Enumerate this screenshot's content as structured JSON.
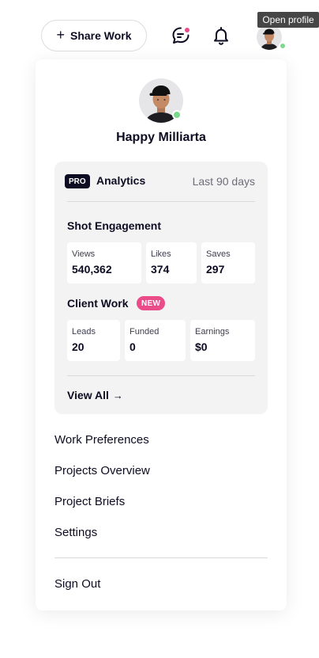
{
  "topbar": {
    "share_label": "Share Work",
    "share_icon": "plus-icon",
    "messages_icon": "chat-bubble-icon",
    "notifications_icon": "bell-icon",
    "tooltip": "Open profile",
    "accent_color": "#ea4c89",
    "online_color": "#7bd88f"
  },
  "profile": {
    "name": "Happy Milliarta"
  },
  "analytics": {
    "badge": "PRO",
    "title": "Analytics",
    "range": "Last 90 days",
    "shot_engagement": {
      "title": "Shot Engagement",
      "stats": [
        {
          "label": "Views",
          "value": "540,362"
        },
        {
          "label": "Likes",
          "value": "374"
        },
        {
          "label": "Saves",
          "value": "297"
        }
      ]
    },
    "client_work": {
      "title": "Client Work",
      "badge": "NEW",
      "stats": [
        {
          "label": "Leads",
          "value": "20"
        },
        {
          "label": "Funded",
          "value": "0"
        },
        {
          "label": "Earnings",
          "value": "$0"
        }
      ]
    },
    "view_all": "View All",
    "view_all_arrow": "→"
  },
  "menu": {
    "items": [
      {
        "label": "Work Preferences"
      },
      {
        "label": "Projects Overview"
      },
      {
        "label": "Project Briefs"
      },
      {
        "label": "Settings"
      }
    ],
    "sign_out": "Sign Out"
  }
}
